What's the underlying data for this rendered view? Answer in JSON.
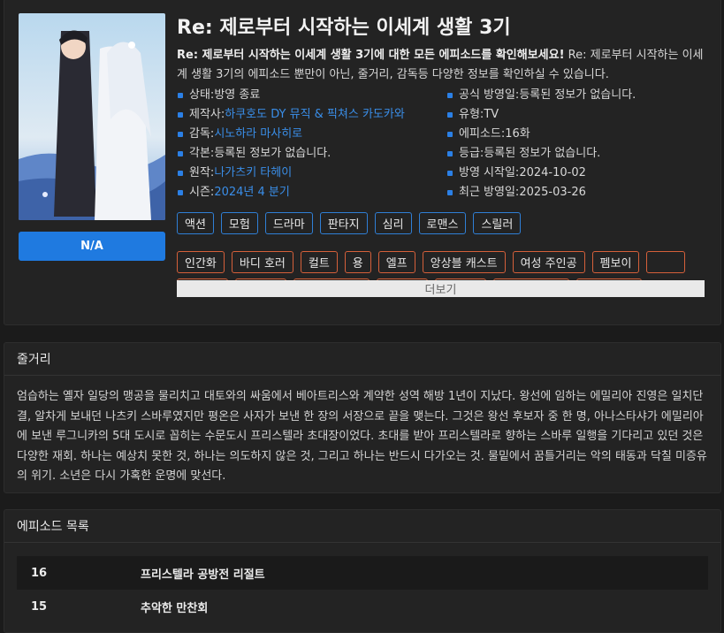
{
  "anime": {
    "title": "Re: 제로부터 시작하는 이세계 생활 3기",
    "description_bold": "Re: 제로부터 시작하는 이세계 생활 3기에 대한 모든 에피소드를 확인해보세요!",
    "description_rest": " Re: 제로부터 시작하는 이세계 생활 3기의 에피소드 뿐만이 아닌, 줄거리, 감독등 다양한 정보를 확인하실 수 있습니다.",
    "na_button": "N/A"
  },
  "meta_left": [
    {
      "label": "상태: ",
      "value": "방영 종료",
      "link": false
    },
    {
      "label": "제작사: ",
      "value": "하쿠호도 DY 뮤직 & 픽쳐스 카도카와",
      "link": true
    },
    {
      "label": "감독: ",
      "value": "시노하라 마사히로",
      "link": true
    },
    {
      "label": "각본: ",
      "value": "등록된 정보가 없습니다.",
      "link": false
    },
    {
      "label": "원작: ",
      "value": "나가츠키 타헤이",
      "link": true
    },
    {
      "label": "시즌: ",
      "value": "2024년 4 분기",
      "link": true
    }
  ],
  "meta_right": [
    {
      "label": "공식 방영일: ",
      "value": "등록된 정보가 없습니다.",
      "link": false
    },
    {
      "label": "유형: ",
      "value": "TV",
      "link": false
    },
    {
      "label": "에피소드: ",
      "value": "16화",
      "link": false
    },
    {
      "label": "등급: ",
      "value": "등록된 정보가 없습니다.",
      "link": false
    },
    {
      "label": "방영 시작일: ",
      "value": "2024-10-02",
      "link": false
    },
    {
      "label": "최근 방영일: ",
      "value": "2025-03-26",
      "link": false
    }
  ],
  "genres": [
    "액션",
    "모험",
    "드라마",
    "판타지",
    "심리",
    "로맨스",
    "스릴러"
  ],
  "themes": [
    "인간화",
    "바디 호러",
    "컬트",
    "용",
    "엘프",
    "앙상블 캐스트",
    "여성 주인공",
    "펨보이",
    "",
    "",
    "",
    "",
    "",
    "",
    "",
    ""
  ],
  "more_button": "더보기",
  "synopsis": {
    "header": "줄거리",
    "text": "엄습하는 옐자 일당의 맹공을 물리치고 대토와의 싸움에서 베아트리스와 계약한 성역 해방 1년이 지났다. 왕선에 임하는 에밀리아 진영은 일치단결, 알차게 보내던 나츠키 스바루였지만 평온은 사자가 보낸 한 장의 서장으로 끝을 맺는다. 그것은 왕선 후보자 중 한 명, 아나스타샤가 에밀리아에 보낸 루그니카의 5대 도시로 꼽히는 수문도시 프리스텔라 초대장이었다. 초대를 받아 프리스텔라로 향하는 스바루 일행을 기다리고 있던 것은 다양한 재회. 하나는 예상치 못한 것, 하나는 의도하지 않은 것, 그리고 하나는 반드시 다가오는 것. 물밑에서 꿈틀거리는 악의 태동과 닥칠 미증유의 위기. 소년은 다시 가혹한 운명에 맞선다."
  },
  "episodes": {
    "header": "에피소드 목록",
    "items": [
      {
        "num": "16",
        "title": "프리스텔라 공방전 리절트"
      },
      {
        "num": "15",
        "title": "추악한 만찬회"
      }
    ]
  },
  "colors": {
    "accent": "#1f7ae0",
    "genre_border": "#2f7fd6",
    "theme_border": "#d5603a",
    "link": "#3a8ee8"
  }
}
